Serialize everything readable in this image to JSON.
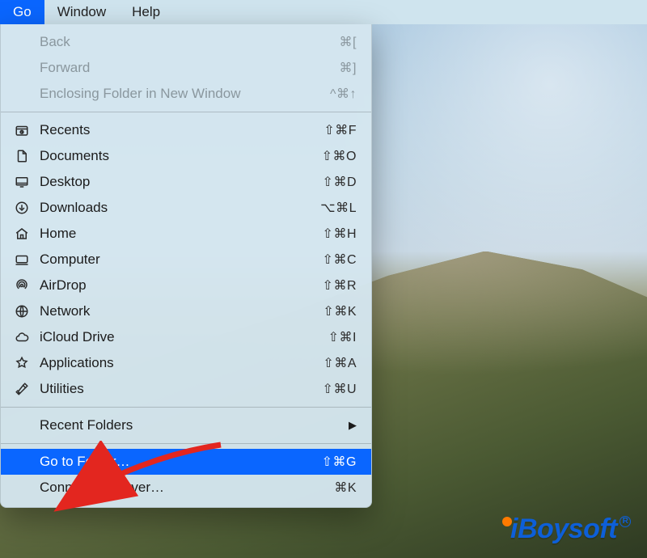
{
  "menubar": {
    "items": [
      {
        "label": "Go",
        "active": true
      },
      {
        "label": "Window",
        "active": false
      },
      {
        "label": "Help",
        "active": false
      }
    ]
  },
  "menu": {
    "sections": [
      [
        {
          "label": "Back",
          "shortcut": "⌘[",
          "disabled": true
        },
        {
          "label": "Forward",
          "shortcut": "⌘]",
          "disabled": true
        },
        {
          "label": "Enclosing Folder in New Window",
          "shortcut": "^⌘↑",
          "disabled": true
        }
      ],
      [
        {
          "icon": "recents-icon",
          "label": "Recents",
          "shortcut": "⇧⌘F"
        },
        {
          "icon": "documents-icon",
          "label": "Documents",
          "shortcut": "⇧⌘O"
        },
        {
          "icon": "desktop-icon",
          "label": "Desktop",
          "shortcut": "⇧⌘D"
        },
        {
          "icon": "downloads-icon",
          "label": "Downloads",
          "shortcut": "⌥⌘L"
        },
        {
          "icon": "home-icon",
          "label": "Home",
          "shortcut": "⇧⌘H"
        },
        {
          "icon": "computer-icon",
          "label": "Computer",
          "shortcut": "⇧⌘C"
        },
        {
          "icon": "airdrop-icon",
          "label": "AirDrop",
          "shortcut": "⇧⌘R"
        },
        {
          "icon": "network-icon",
          "label": "Network",
          "shortcut": "⇧⌘K"
        },
        {
          "icon": "icloud-icon",
          "label": "iCloud Drive",
          "shortcut": "⇧⌘I"
        },
        {
          "icon": "applications-icon",
          "label": "Applications",
          "shortcut": "⇧⌘A"
        },
        {
          "icon": "utilities-icon",
          "label": "Utilities",
          "shortcut": "⇧⌘U"
        }
      ],
      [
        {
          "label": "Recent Folders",
          "submenu": true
        }
      ],
      [
        {
          "label": "Go to Folder…",
          "shortcut": "⇧⌘G",
          "highlight": true
        },
        {
          "label": "Connect to Server…",
          "shortcut": "⌘K"
        }
      ]
    ]
  },
  "watermark": {
    "text": "iBoysoft"
  }
}
